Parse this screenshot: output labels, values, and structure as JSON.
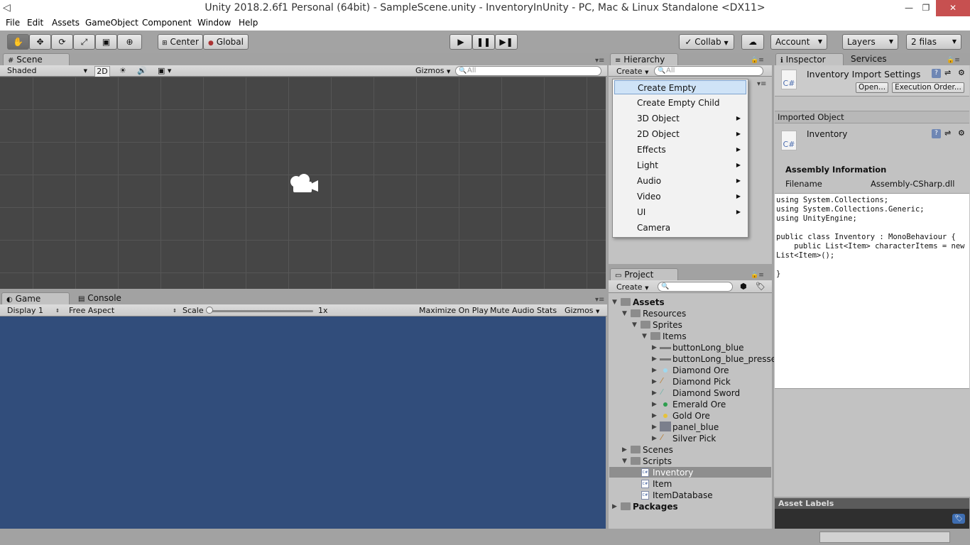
{
  "window": {
    "title": "Unity 2018.2.6f1 Personal (64bit) - SampleScene.unity - InventoryInUnity - PC, Mac & Linux Standalone <DX11>",
    "minimize": "—",
    "maximize": "❐",
    "close": "✕"
  },
  "menubar": [
    "File",
    "Edit",
    "Assets",
    "GameObject",
    "Component",
    "Window",
    "Help"
  ],
  "toolbar": {
    "tools": [
      "hand-icon",
      "move-icon",
      "rotate-icon",
      "scale-icon",
      "rect-icon",
      "transform-icon"
    ],
    "pivot": "Center",
    "space": "Global",
    "collab": "Collab",
    "account": "Account",
    "layers": "Layers",
    "layout": "2 filas"
  },
  "scene": {
    "tab": "Scene",
    "shading": "Shaded",
    "mode2d": "2D",
    "gizmos": "Gizmos",
    "search_placeholder": "All"
  },
  "game": {
    "tab": "Game",
    "console_tab": "Console",
    "display": "Display 1",
    "aspect": "Free Aspect",
    "scale_label": "Scale",
    "scale_value": "1x",
    "maximize": "Maximize On Play",
    "mute": "Mute Audio",
    "stats": "Stats",
    "gizmos": "Gizmos"
  },
  "hierarchy": {
    "tab": "Hierarchy",
    "create": "Create",
    "search_placeholder": "All"
  },
  "create_menu": [
    {
      "label": "Create Empty",
      "submenu": false,
      "selected": true
    },
    {
      "label": "Create Empty Child",
      "submenu": false
    },
    {
      "label": "3D Object",
      "submenu": true
    },
    {
      "label": "2D Object",
      "submenu": true
    },
    {
      "label": "Effects",
      "submenu": true
    },
    {
      "label": "Light",
      "submenu": true
    },
    {
      "label": "Audio",
      "submenu": true
    },
    {
      "label": "Video",
      "submenu": true
    },
    {
      "label": "UI",
      "submenu": true
    },
    {
      "label": "Camera",
      "submenu": false
    }
  ],
  "project": {
    "tab": "Project",
    "create": "Create",
    "tree": {
      "assets": "Assets",
      "resources": "Resources",
      "sprites": "Sprites",
      "items": "Items",
      "sprite_items": [
        "buttonLong_blue",
        "buttonLong_blue_presse",
        "Diamond Ore",
        "Diamond Pick",
        "Diamond Sword",
        "Emerald Ore",
        "Gold Ore",
        "panel_blue",
        "Silver Pick"
      ],
      "scenes": "Scenes",
      "scripts": "Scripts",
      "script_items": [
        "Inventory",
        "Item",
        "ItemDatabase"
      ],
      "selected_script": "Inventory",
      "packages": "Packages"
    }
  },
  "inspector": {
    "tab": "Inspector",
    "services_tab": "Services",
    "header_title": "Inventory Import Settings",
    "open_button": "Open...",
    "execution_order_button": "Execution Order...",
    "imported_object": "Imported Object",
    "object_name": "Inventory",
    "assembly_title": "Assembly Information",
    "filename_label": "Filename",
    "filename_value": "Assembly-CSharp.dll",
    "code": "using System.Collections;\nusing System.Collections.Generic;\nusing UnityEngine;\n\npublic class Inventory : MonoBehaviour {\n    public List<Item> characterItems = new\nList<Item>();\n\n}",
    "asset_labels": "Asset Labels",
    "cs_label": "C#"
  }
}
